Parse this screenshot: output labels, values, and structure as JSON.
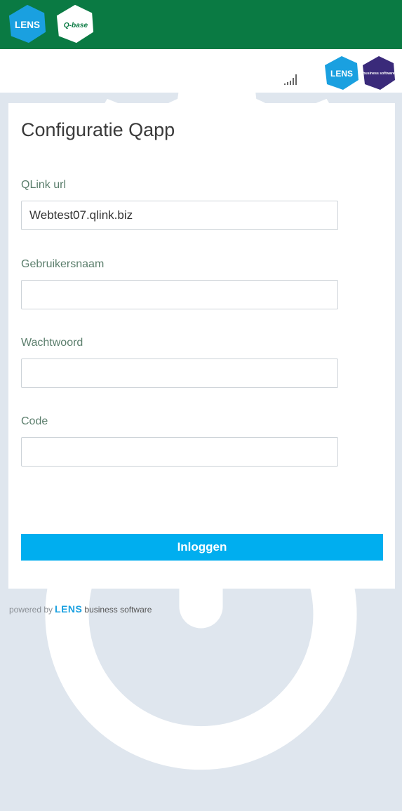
{
  "header": {
    "lens_logo_text": "LENS",
    "qbase_logo_text": "Q-base",
    "settings_icon": "gear-icon",
    "power_icon": "power-icon"
  },
  "subheader": {
    "signal_icon": "signal-strength-icon",
    "brand_lens_text": "LENS",
    "brand_bs_text": "business software"
  },
  "form": {
    "title": "Configuratie Qapp",
    "qlink_label": "QLink url",
    "qlink_value": "Webtest07.qlink.biz",
    "username_label": "Gebruikersnaam",
    "username_value": "",
    "password_label": "Wachtwoord",
    "password_value": "",
    "code_label": "Code",
    "code_value": "",
    "login_label": "Inloggen"
  },
  "footer": {
    "powered_by": "powered by",
    "lens": "LENS",
    "business_software": "business software"
  },
  "colors": {
    "header_green": "#0a7a43",
    "accent_blue": "#00aeef",
    "lens_cyan": "#1aa0e0",
    "bs_purple": "#3a2a7a"
  }
}
